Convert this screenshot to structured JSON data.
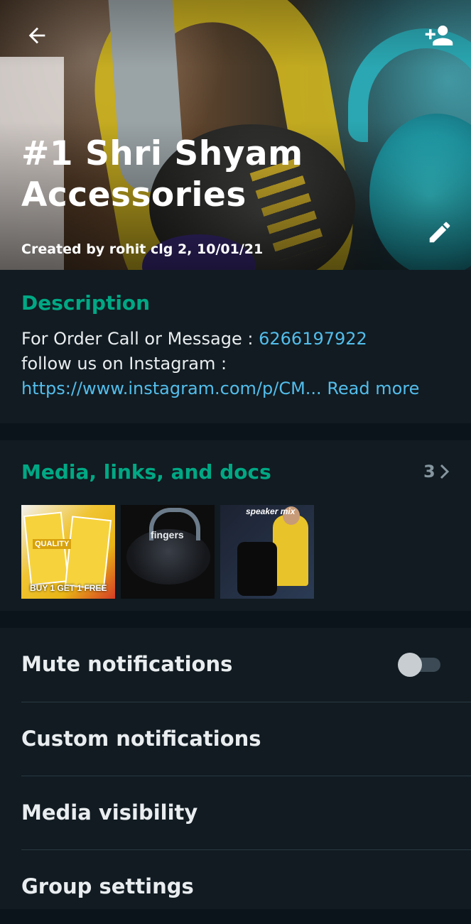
{
  "header": {
    "title": "#1 Shri Shyam Accessories",
    "created_by": "Created by rohit clg 2, 10/01/21"
  },
  "description": {
    "heading": "Description",
    "line1_prefix": "For Order Call or Message : ",
    "phone": "6266197922",
    "line2": "follow us on Instagram :",
    "link": "https://www.instagram.com/p/CM...",
    "read_more": "Read more"
  },
  "media": {
    "heading": "Media, links, and docs",
    "count": "3",
    "thumbs": [
      {
        "caption": "BUY 1 GET 1 FREE",
        "tag": "QUALITY"
      },
      {
        "caption": "fingers"
      },
      {
        "caption": "speaker mix"
      }
    ]
  },
  "settings": {
    "mute": "Mute notifications",
    "custom": "Custom notifications",
    "visibility": "Media visibility",
    "group": "Group settings"
  },
  "colors": {
    "accent": "#00a884",
    "link": "#53bdeb",
    "background": "#111b21"
  }
}
